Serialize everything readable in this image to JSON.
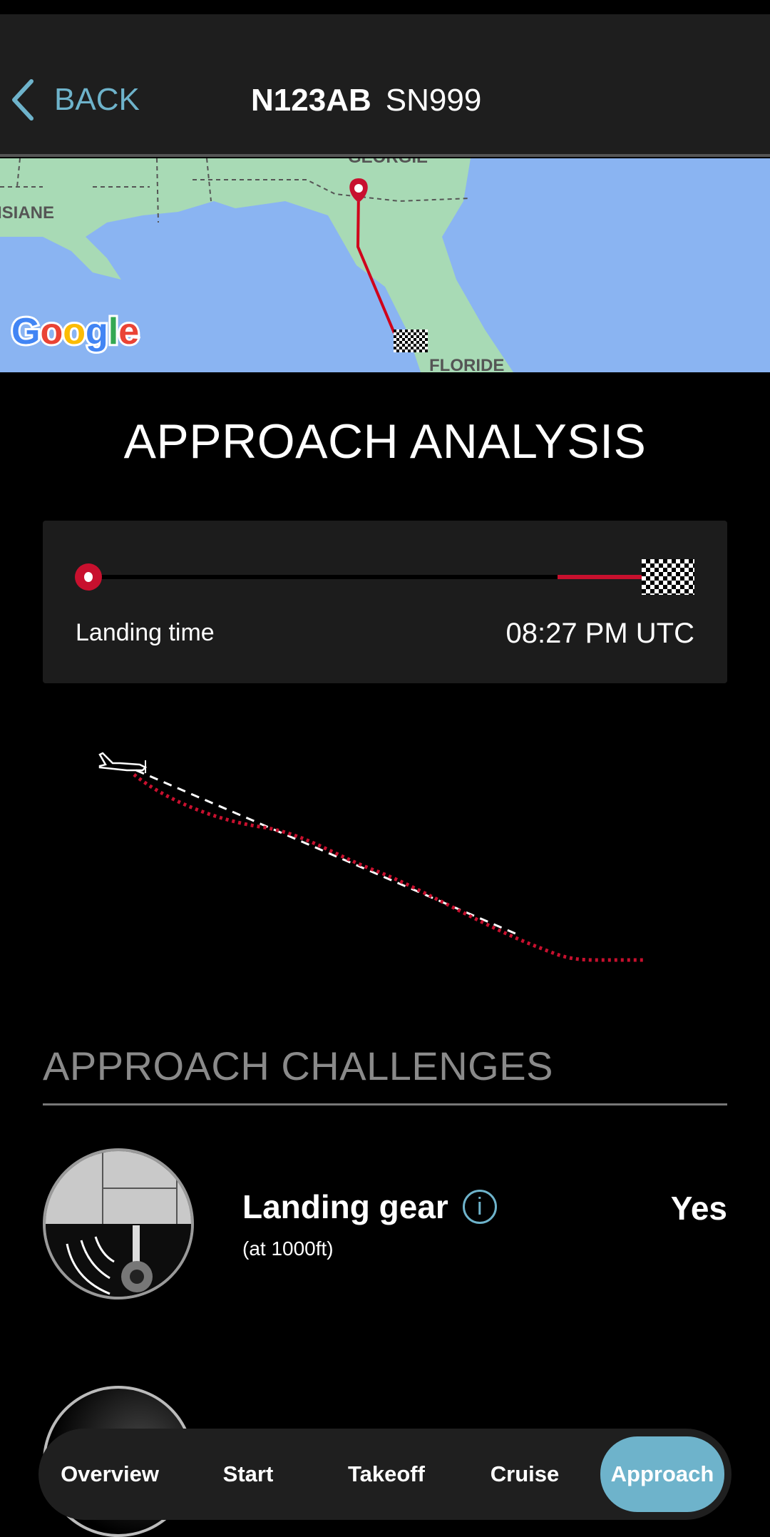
{
  "header": {
    "back_label": "BACK",
    "registration": "N123AB",
    "serial": "SN999"
  },
  "map": {
    "labels": [
      "GEORGIE",
      "ISIANE",
      "FLORIDE"
    ],
    "logo": "Google",
    "route_color": "#c8102e"
  },
  "page_title": "APPROACH ANALYSIS",
  "timeline": {
    "label": "Landing time",
    "value": "08:27 PM UTC",
    "progress": 1.0
  },
  "approach_chart": {
    "type": "line",
    "series": [
      {
        "style": "dashed",
        "color": "#ffffff"
      },
      {
        "style": "dotted",
        "color": "#c8102e"
      }
    ]
  },
  "challenges": {
    "title": "APPROACH CHALLENGES",
    "items": [
      {
        "name": "Landing gear",
        "sub": "(at 1000ft)",
        "value": "Yes",
        "icon": "landing-gear-icon"
      }
    ]
  },
  "nav": {
    "tabs": [
      {
        "label": "Overview"
      },
      {
        "label": "Start"
      },
      {
        "label": "Takeoff"
      },
      {
        "label": "Cruise"
      },
      {
        "label": "Approach"
      }
    ],
    "active": "Approach"
  },
  "colors": {
    "accent": "#6eb3cb",
    "red": "#c8102e",
    "header_bg": "#1e1e1e"
  }
}
